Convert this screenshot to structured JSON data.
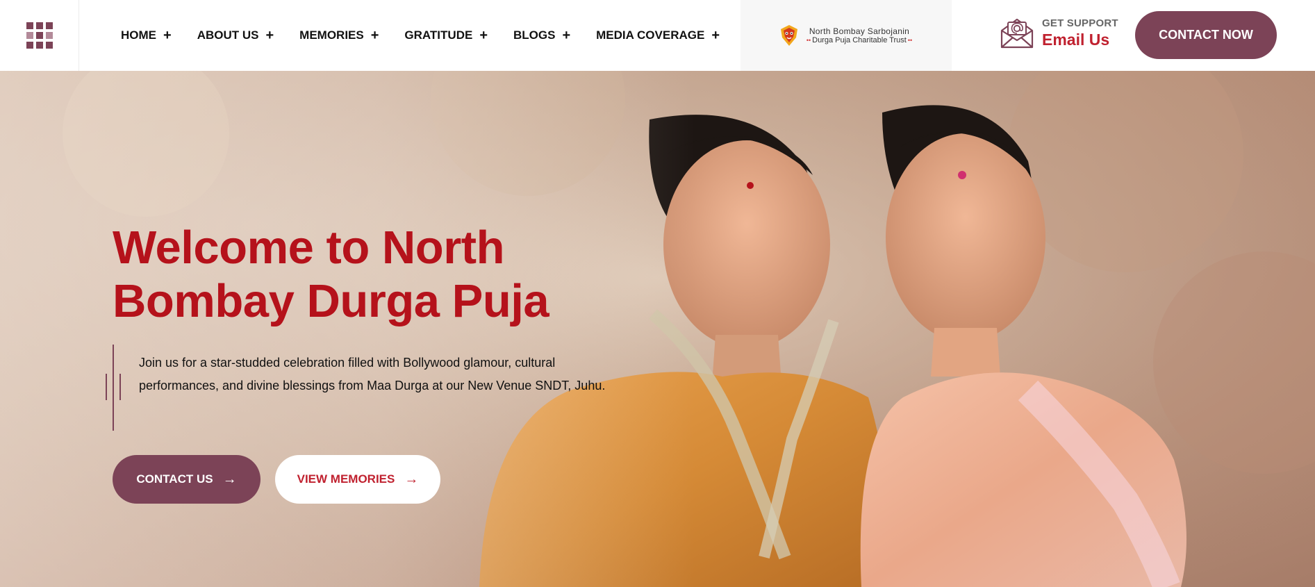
{
  "nav": {
    "items": [
      {
        "label": "HOME",
        "icon": "plus-icon"
      },
      {
        "label": "ABOUT US",
        "icon": "plus-icon"
      },
      {
        "label": "MEMORIES",
        "icon": "plus-icon"
      },
      {
        "label": "GRATITUDE",
        "icon": "plus-icon"
      },
      {
        "label": "BLOGS",
        "icon": "plus-icon"
      },
      {
        "label": "MEDIA COVERAGE",
        "icon": "plus-icon"
      }
    ],
    "plus": "+"
  },
  "logo": {
    "line1": "North Bombay Sarbojanin",
    "line2": "Durga Puja Charitable Trust",
    "dots": "••"
  },
  "support": {
    "label": "GET SUPPORT",
    "value": "Email Us",
    "icon": "email-envelope-icon"
  },
  "header": {
    "contact_now": "CONTACT NOW"
  },
  "hero": {
    "title": "Welcome to North Bombay Durga Puja",
    "description": "Join us for a star-studded celebration filled with Bollywood glamour, cultural performances, and divine blessings from Maa Durga at our New Venue SNDT, Juhu.",
    "contact_us": "CONTACT US",
    "view_memories": "VIEW MEMORIES",
    "arrow": "→"
  },
  "colors": {
    "brand": "#7c4357",
    "accent": "#b5121b",
    "link": "#c0212f"
  }
}
